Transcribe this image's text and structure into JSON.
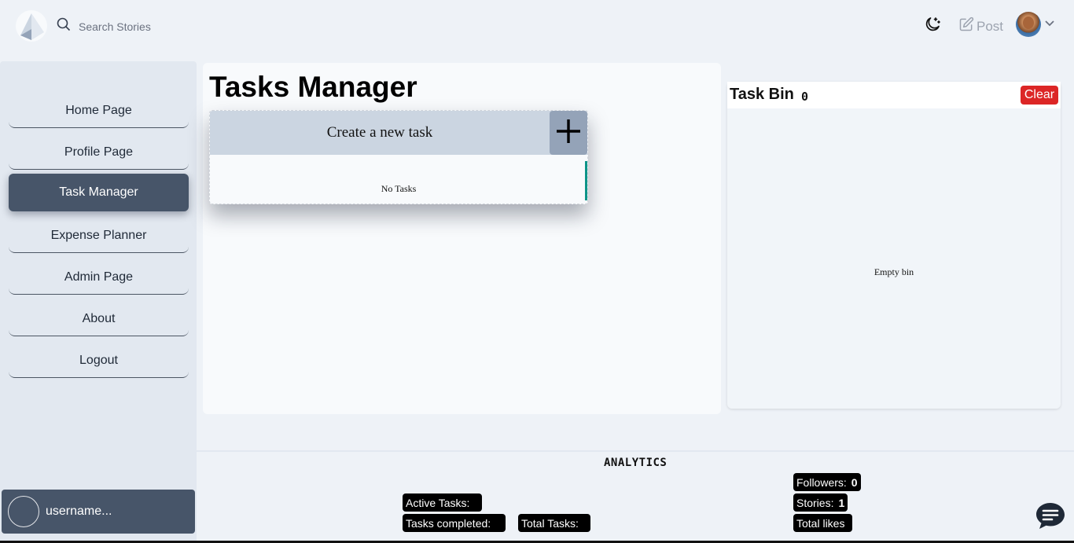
{
  "header": {
    "search_placeholder": "Search Stories",
    "post_label": "Post",
    "theme_icon": "moon-star-icon"
  },
  "sidebar": {
    "items": [
      {
        "label": "Home Page",
        "active": false
      },
      {
        "label": "Profile Page",
        "active": false
      },
      {
        "label": "Task Manager",
        "active": true
      },
      {
        "label": "Expense Planner",
        "active": false
      },
      {
        "label": "Admin Page",
        "active": false
      },
      {
        "label": "About",
        "active": false
      },
      {
        "label": "Logout",
        "active": false
      }
    ],
    "username": "username..."
  },
  "main": {
    "title": "Tasks Manager",
    "create_label": "Create a new task",
    "empty_tasks": "No Tasks"
  },
  "bin": {
    "title": "Task Bin",
    "count": "0",
    "clear_label": "Clear",
    "empty_label": "Empty bin"
  },
  "analytics": {
    "title": "ANALYTICS",
    "active_tasks_label": "Active Tasks:",
    "active_tasks_value": "",
    "tasks_completed_label": "Tasks completed:",
    "tasks_completed_value": "",
    "total_tasks_label": "Total Tasks:",
    "total_tasks_value": "",
    "followers_label": "Followers:",
    "followers_value": "0",
    "stories_label": "Stories:",
    "stories_value": "1",
    "total_likes_label": "Total likes",
    "total_likes_value": ""
  },
  "colors": {
    "sidebar_bg": "#e2e8f0",
    "active_nav": "#475569",
    "clear_button": "#dc2626",
    "create_bar": "#cbd5e1",
    "add_button": "#94a3b8",
    "accent_teal": "#0d9488"
  }
}
